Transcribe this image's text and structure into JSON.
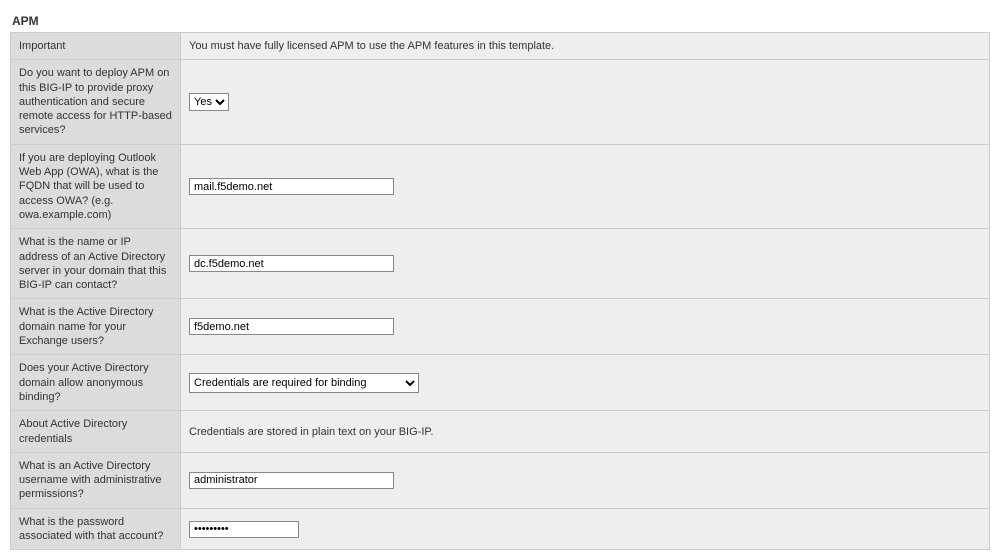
{
  "section": {
    "title": "APM"
  },
  "rows": {
    "important": {
      "label": "Important",
      "value": "You must have fully licensed APM to use the APM features in this template."
    },
    "deploy_apm": {
      "label": "Do you want to deploy APM on this BIG-IP to provide proxy authentication and secure remote access for HTTP-based services?",
      "selected": "Yes"
    },
    "owa_fqdn": {
      "label": "If you are deploying Outlook Web App (OWA), what is the FQDN that will be used to access OWA? (e.g. owa.example.com)",
      "value": "mail.f5demo.net"
    },
    "ad_server": {
      "label": "What is the name or IP address of an Active Directory server in your domain that this BIG-IP can contact?",
      "value": "dc.f5demo.net"
    },
    "ad_domain": {
      "label": "What is the Active Directory domain name for your Exchange users?",
      "value": "f5demo.net"
    },
    "anon_binding": {
      "label": "Does your Active Directory domain allow anonymous binding?",
      "selected": "Credentials are required for binding"
    },
    "about_creds": {
      "label": "About Active Directory credentials",
      "value": "Credentials are stored in plain text on your BIG-IP."
    },
    "ad_user": {
      "label": "What is an Active Directory username with administrative permissions?",
      "value": "administrator"
    },
    "ad_pass": {
      "label": "What is the password associated with that account?",
      "value": "•••••••••"
    }
  }
}
